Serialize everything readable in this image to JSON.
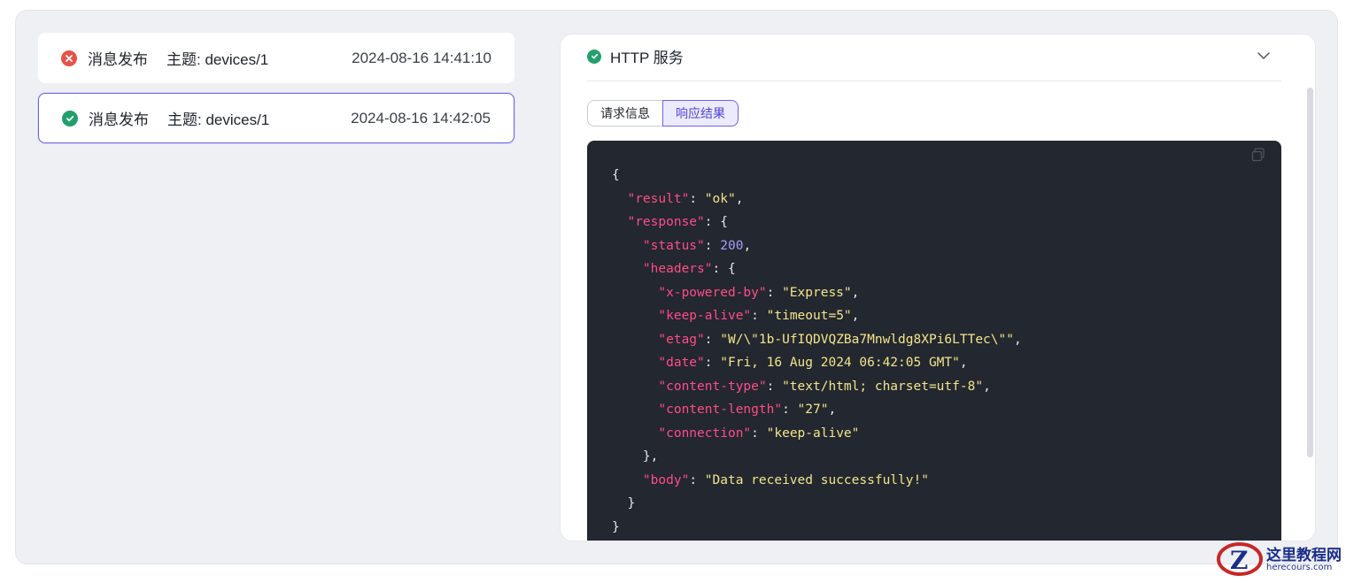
{
  "events": [
    {
      "status": "error",
      "title": "消息发布",
      "topic": "主题: devices/1",
      "time": "2024-08-16 14:41:10",
      "selected": false
    },
    {
      "status": "success",
      "title": "消息发布",
      "topic": "主题: devices/1",
      "time": "2024-08-16 14:42:05",
      "selected": true
    }
  ],
  "panel": {
    "title": "HTTP 服务",
    "tabs": [
      "请求信息",
      "响应结果"
    ],
    "active_tab": "响应结果"
  },
  "code_lines": [
    "{",
    "  \"result\": \"ok\",",
    "  \"response\": {",
    "    \"status\": 200,",
    "    \"headers\": {",
    "      \"x-powered-by\": \"Express\",",
    "      \"keep-alive\": \"timeout=5\",",
    "      \"etag\": \"W/\\\"1b-UfIQDVQZBa7Mnwldg8XPi6LTTec\\\"\",",
    "      \"date\": \"Fri, 16 Aug 2024 06:42:05 GMT\",",
    "      \"content-type\": \"text/html; charset=utf-8\",",
    "      \"content-length\": \"27\",",
    "      \"connection\": \"keep-alive\"",
    "    },",
    "    \"body\": \"Data received successfully!\"",
    "  }",
    "}"
  ],
  "colors": {
    "accent": "#6d63e6",
    "error": "#e5534b",
    "success": "#22a06b",
    "code_bg": "#23272f",
    "json_key": "#ff4d86",
    "json_string": "#f2e58c",
    "json_number": "#a99cff"
  },
  "watermark": {
    "line1": "这里教程网",
    "line2": "herecours.com"
  }
}
